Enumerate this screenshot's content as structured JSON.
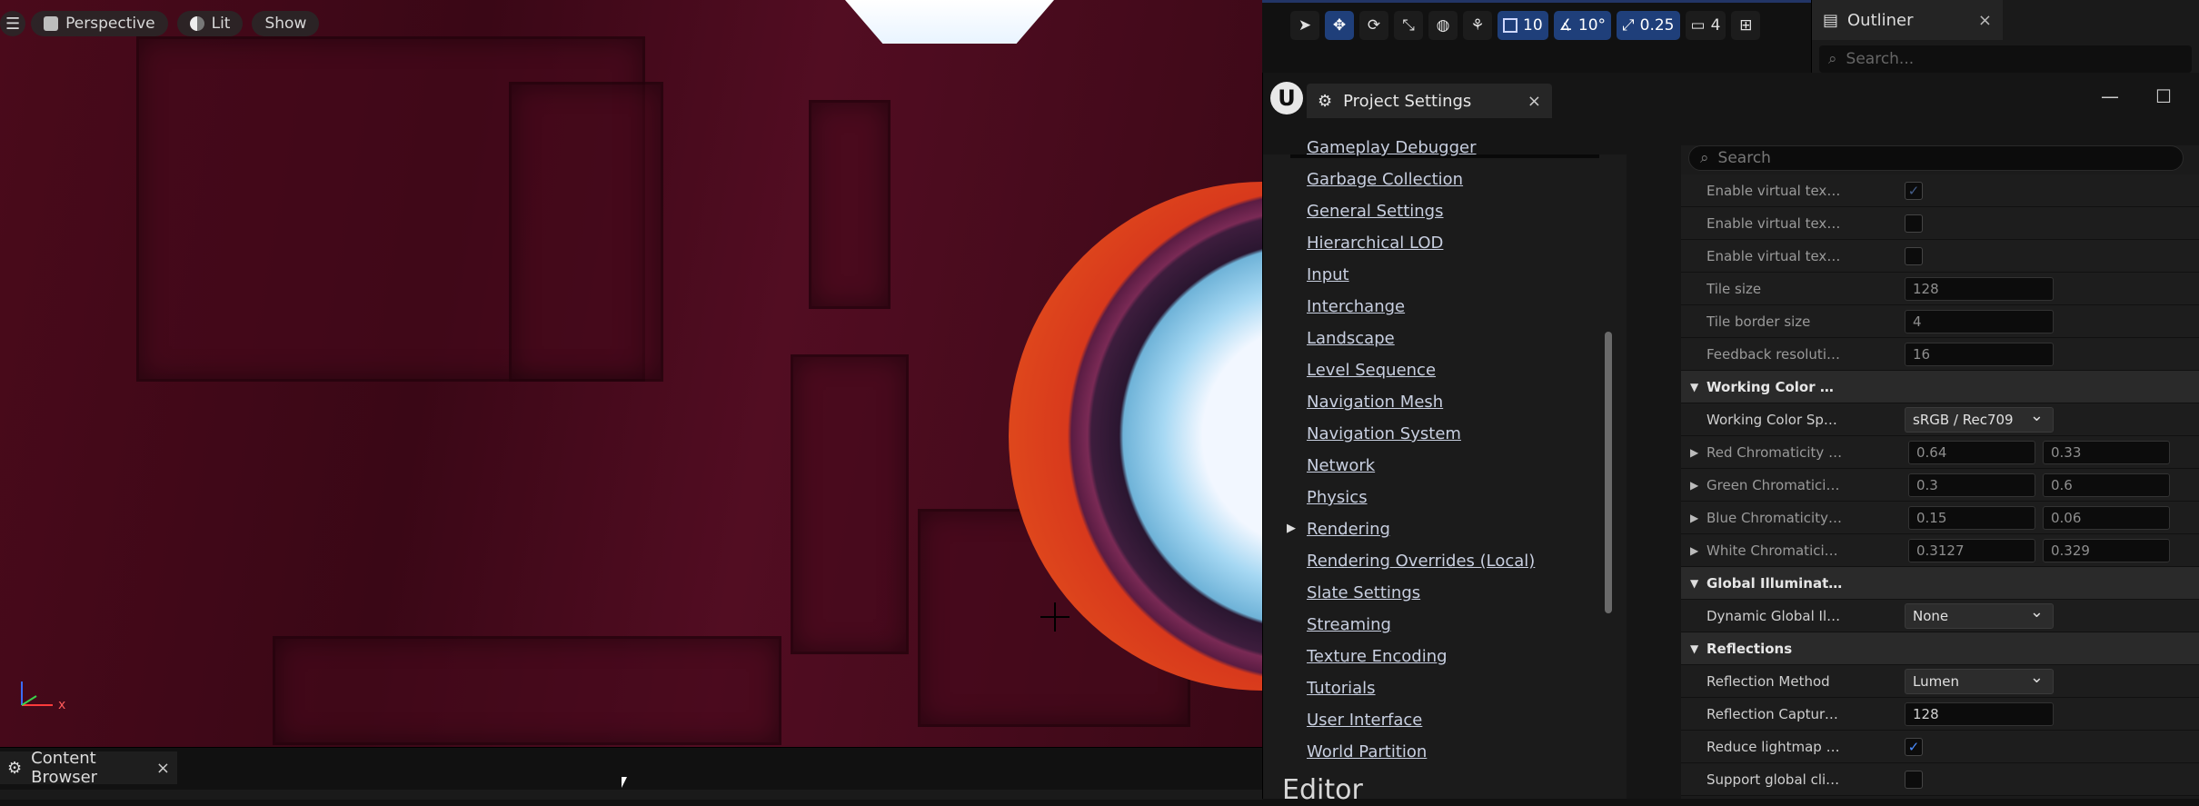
{
  "viewport": {
    "menu_icon": "hamburger-icon",
    "perspective_label": "Perspective",
    "lit_label": "Lit",
    "show_label": "Show",
    "grid_snap": "10",
    "rotation_snap": "10°",
    "scale_snap": "0.25",
    "camera_speed": "4",
    "axis_x": "x"
  },
  "outliner": {
    "title": "Outliner",
    "close": "×",
    "search_placeholder": "Search..."
  },
  "project_settings": {
    "title": "Project Settings",
    "close": "×",
    "minimize": "—",
    "maximize": "☐",
    "categories": [
      "Gameplay Debugger",
      "Garbage Collection",
      "General Settings",
      "Hierarchical LOD",
      "Input",
      "Interchange",
      "Landscape",
      "Level Sequence",
      "Navigation Mesh",
      "Navigation System",
      "Network",
      "Physics",
      "Rendering",
      "Rendering Overrides (Local)",
      "Slate Settings",
      "Streaming",
      "Texture Encoding",
      "Tutorials",
      "User Interface",
      "World Partition"
    ],
    "editor_heading": "Editor",
    "details_search_placeholder": "Search",
    "rows": {
      "r0": {
        "label": "Enable virtual texture on te..."
      },
      "r1": {
        "label": "Enable virtual texture light..."
      },
      "r2": {
        "label": "Enable virtual texture aniso..."
      },
      "r3": {
        "label": "Tile size",
        "value": "128"
      },
      "r4": {
        "label": "Tile border size",
        "value": "4"
      },
      "r5": {
        "label": "Feedback resolution factor",
        "value": "16"
      },
      "s1": {
        "label": "Working Color Space"
      },
      "r6": {
        "label": "Working Color Space",
        "value": "sRGB / Rec709"
      },
      "r7": {
        "label": "Red Chromaticity Coordinate",
        "a": "0.64",
        "b": "0.33"
      },
      "r8": {
        "label": "Green Chromaticity Coordin...",
        "a": "0.3",
        "b": "0.6"
      },
      "r9": {
        "label": "Blue Chromaticity Coordinate",
        "a": "0.15",
        "b": "0.06"
      },
      "r10": {
        "label": "White Chromaticity Coordin...",
        "a": "0.3127",
        "b": "0.329"
      },
      "s2": {
        "label": "Global Illumination"
      },
      "r11": {
        "label": "Dynamic Global Illuminatio...",
        "value": "None"
      },
      "s3": {
        "label": "Reflections"
      },
      "r12": {
        "label": "Reflection Method",
        "value": "Lumen"
      },
      "r13": {
        "label": "Reflection Capture Resoluti...",
        "value": "128"
      },
      "r14": {
        "label": "Reduce lightmap mixing on..."
      },
      "r15": {
        "label": "Support global clip plane fo..."
      }
    },
    "checkmark": "✓"
  },
  "content_browser": {
    "title": "Content Browser",
    "close": "×"
  },
  "colors": {
    "accent": "#2f6fe0",
    "wall": "#3a0716",
    "ring": "#d8391c"
  }
}
